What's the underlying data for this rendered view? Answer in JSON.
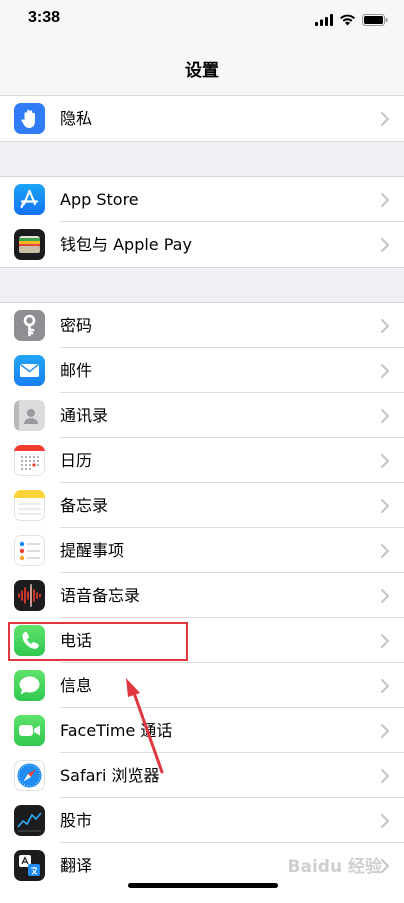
{
  "status_bar": {
    "time": "3:38"
  },
  "nav": {
    "title": "设置"
  },
  "groups": [
    {
      "items": [
        {
          "label": "隐私",
          "icon": "hand-privacy-icon"
        }
      ]
    },
    {
      "items": [
        {
          "label": "App Store",
          "icon": "app-store-icon"
        },
        {
          "label": "钱包与 Apple Pay",
          "icon": "wallet-icon"
        }
      ]
    },
    {
      "items": [
        {
          "label": "密码",
          "icon": "key-icon"
        },
        {
          "label": "邮件",
          "icon": "mail-icon"
        },
        {
          "label": "通讯录",
          "icon": "contacts-icon"
        },
        {
          "label": "日历",
          "icon": "calendar-icon"
        },
        {
          "label": "备忘录",
          "icon": "notes-icon"
        },
        {
          "label": "提醒事项",
          "icon": "reminders-icon"
        },
        {
          "label": "语音备忘录",
          "icon": "voice-memos-icon"
        },
        {
          "label": "电话",
          "icon": "phone-icon"
        },
        {
          "label": "信息",
          "icon": "messages-icon"
        },
        {
          "label": "FaceTime 通话",
          "icon": "facetime-icon"
        },
        {
          "label": "Safari 浏览器",
          "icon": "safari-icon"
        },
        {
          "label": "股市",
          "icon": "stocks-icon"
        },
        {
          "label": "翻译",
          "icon": "translate-icon"
        }
      ]
    }
  ],
  "annotation": {
    "highlight_color": "#e0383e"
  },
  "watermark": "Baidu 经验"
}
